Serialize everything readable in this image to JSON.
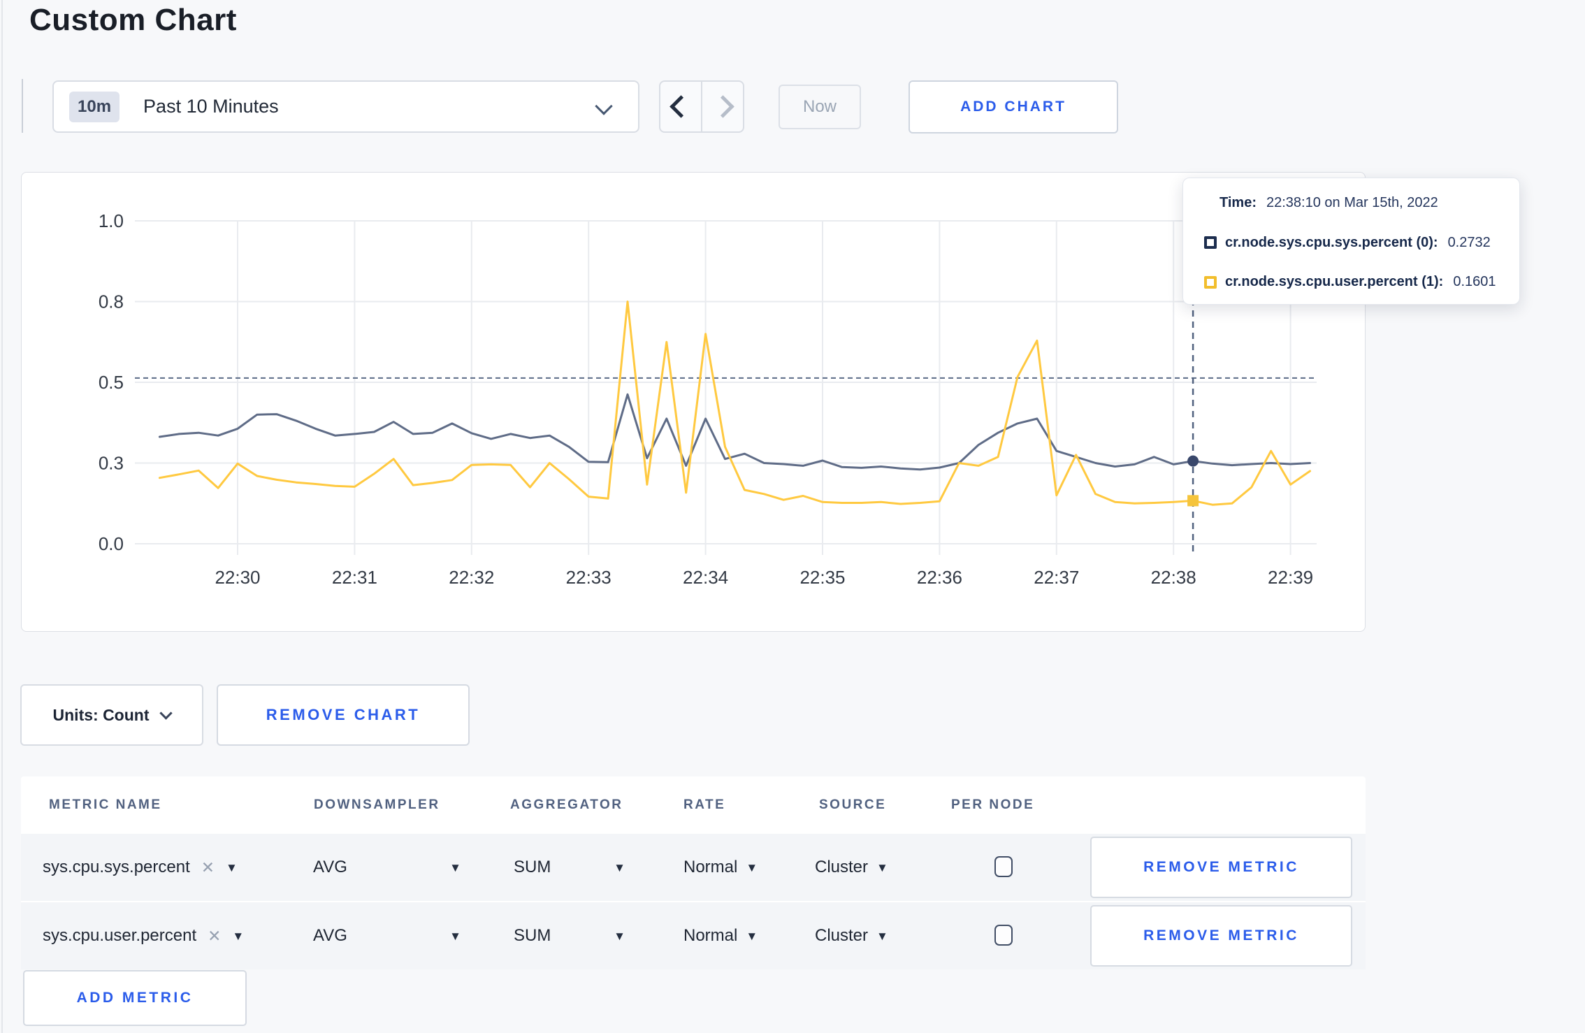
{
  "page": {
    "title": "Custom Chart"
  },
  "toolbar": {
    "time_range_badge": "10m",
    "time_range_label": "Past 10 Minutes",
    "now_label": "Now",
    "add_chart_label": "ADD CHART"
  },
  "chart_controls": {
    "units_label": "Units: Count",
    "remove_chart_label": "REMOVE CHART"
  },
  "tooltip": {
    "time_label": "Time:",
    "time_value": "22:38:10 on Mar 15th, 2022",
    "series": [
      {
        "label": "cr.node.sys.cpu.sys.percent (0):",
        "value": "0.2732",
        "swatch_color": "#1C2D4E"
      },
      {
        "label": "cr.node.sys.cpu.user.percent (1):",
        "value": "0.1601",
        "swatch_color": "#F2BE2C"
      }
    ]
  },
  "chart_data": {
    "type": "line",
    "title": "",
    "xlabel": "",
    "ylabel": "",
    "grid": true,
    "legend_position": "tooltip-overlay",
    "x_tick_labels": [
      "22:30",
      "22:31",
      "22:32",
      "22:33",
      "22:34",
      "22:35",
      "22:36",
      "22:37",
      "22:38",
      "22:39"
    ],
    "y_tick_values": [
      0.0,
      0.3,
      0.5,
      0.8,
      1.0
    ],
    "y_tick_labels": [
      "0.0",
      "0.3",
      "0.5",
      "0.8",
      "1.0"
    ],
    "ylim": [
      0.0,
      1.0
    ],
    "x_start_offset_seconds": -40,
    "x_step_seconds": 10,
    "series": [
      {
        "name": "cr.node.sys.cpu.sys.percent (0)",
        "color": "#5F6C87",
        "values": [
          0.365,
          0.372,
          0.375,
          0.368,
          0.385,
          0.42,
          0.421,
          0.405,
          0.385,
          0.368,
          0.372,
          0.377,
          0.402,
          0.372,
          0.375,
          0.398,
          0.374,
          0.36,
          0.372,
          0.362,
          0.368,
          0.34,
          0.303,
          0.302,
          0.47,
          0.312,
          0.41,
          0.29,
          0.41,
          0.31,
          0.323,
          0.3,
          0.296,
          0.29,
          0.306,
          0.285,
          0.282,
          0.287,
          0.28,
          0.276,
          0.283,
          0.3,
          0.345,
          0.375,
          0.398,
          0.41,
          0.33,
          0.315,
          0.3,
          0.287,
          0.295,
          0.315,
          0.295,
          0.305,
          0.298,
          0.292,
          0.296,
          0.3,
          0.296,
          0.3
        ]
      },
      {
        "name": "cr.node.sys.cpu.user.percent (1)",
        "color": "#FFC940",
        "values": [
          0.245,
          0.258,
          0.272,
          0.207,
          0.298,
          0.252,
          0.238,
          0.228,
          0.222,
          0.215,
          0.212,
          0.26,
          0.31,
          0.218,
          0.226,
          0.237,
          0.293,
          0.295,
          0.293,
          0.21,
          0.3,
          0.24,
          0.175,
          0.168,
          0.8,
          0.22,
          0.65,
          0.19,
          0.68,
          0.34,
          0.2,
          0.185,
          0.163,
          0.178,
          0.155,
          0.152,
          0.152,
          0.155,
          0.148,
          0.152,
          0.158,
          0.3,
          0.29,
          0.315,
          0.52,
          0.655,
          0.18,
          0.32,
          0.185,
          0.155,
          0.15,
          0.152,
          0.155,
          0.1601,
          0.145,
          0.15,
          0.21,
          0.33,
          0.22,
          0.27
        ]
      }
    ],
    "hover": {
      "time_offset_seconds": 490,
      "time_text": "22:38:10",
      "guide_value": 0.516,
      "point_values": [
        0.2732,
        0.1601
      ]
    }
  },
  "metrics_table": {
    "headers": [
      "METRIC NAME",
      "DOWNSAMPLER",
      "AGGREGATOR",
      "RATE",
      "SOURCE",
      "PER NODE"
    ],
    "rows": [
      {
        "metric_name": "sys.cpu.sys.percent",
        "downsampler": "AVG",
        "aggregator": "SUM",
        "rate": "Normal",
        "source": "Cluster",
        "per_node_checked": false,
        "remove_label": "REMOVE METRIC"
      },
      {
        "metric_name": "sys.cpu.user.percent",
        "downsampler": "AVG",
        "aggregator": "SUM",
        "rate": "Normal",
        "source": "Cluster",
        "per_node_checked": false,
        "remove_label": "REMOVE METRIC"
      }
    ],
    "add_metric_label": "ADD METRIC"
  }
}
